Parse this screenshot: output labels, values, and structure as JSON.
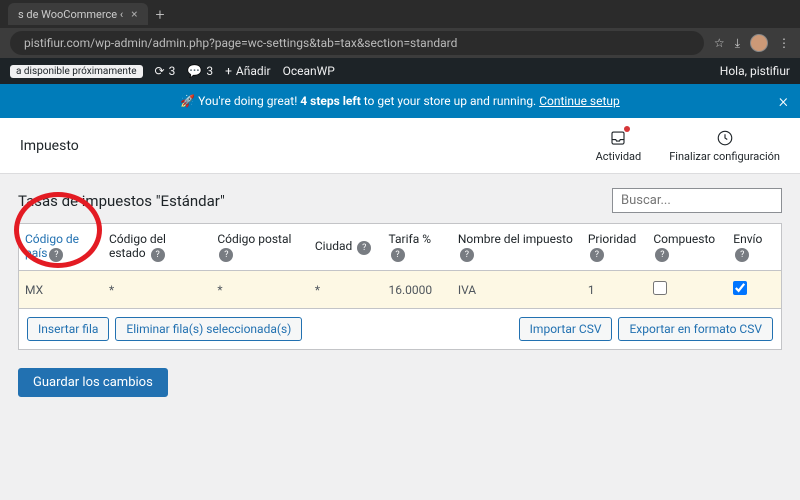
{
  "browser": {
    "tab_title": "s de WooCommerce ‹",
    "url": "pistifiur.com/wp-admin/admin.php?page=wc-settings&tab=tax&section=standard"
  },
  "wp_bar": {
    "coming_soon": "a disponible próximamente",
    "comments_count": "3",
    "updates_count": "3",
    "add_new": "Añadir",
    "theme": "OceanWP",
    "greeting": "Hola, pistifiur"
  },
  "banner": {
    "prefix": "🚀 You're doing great! ",
    "bold": "4 steps left",
    "mid": " to get your store up and running. ",
    "link": "Continue setup"
  },
  "subheader": {
    "title": "Impuesto",
    "activity": "Actividad",
    "finalize": "Finalizar configuración"
  },
  "content": {
    "title": "Tasas de impuestos \"Estándar\"",
    "search_placeholder": "Buscar..."
  },
  "table": {
    "headers": {
      "country": "Código de país",
      "state": "Código del estado",
      "postal": "Código postal",
      "city": "Ciudad",
      "rate": "Tarifa %",
      "name": "Nombre del impuesto",
      "priority": "Prioridad",
      "compound": "Compuesto",
      "shipping": "Envío"
    },
    "row": {
      "country": "MX",
      "state": "*",
      "postal": "*",
      "city": "*",
      "rate": "16.0000",
      "name": "IVA",
      "priority": "1",
      "compound": false,
      "shipping": true
    }
  },
  "buttons": {
    "insert": "Insertar fila",
    "delete": "Eliminar fila(s) seleccionada(s)",
    "import": "Importar CSV",
    "export": "Exportar en formato CSV",
    "save": "Guardar los cambios"
  }
}
